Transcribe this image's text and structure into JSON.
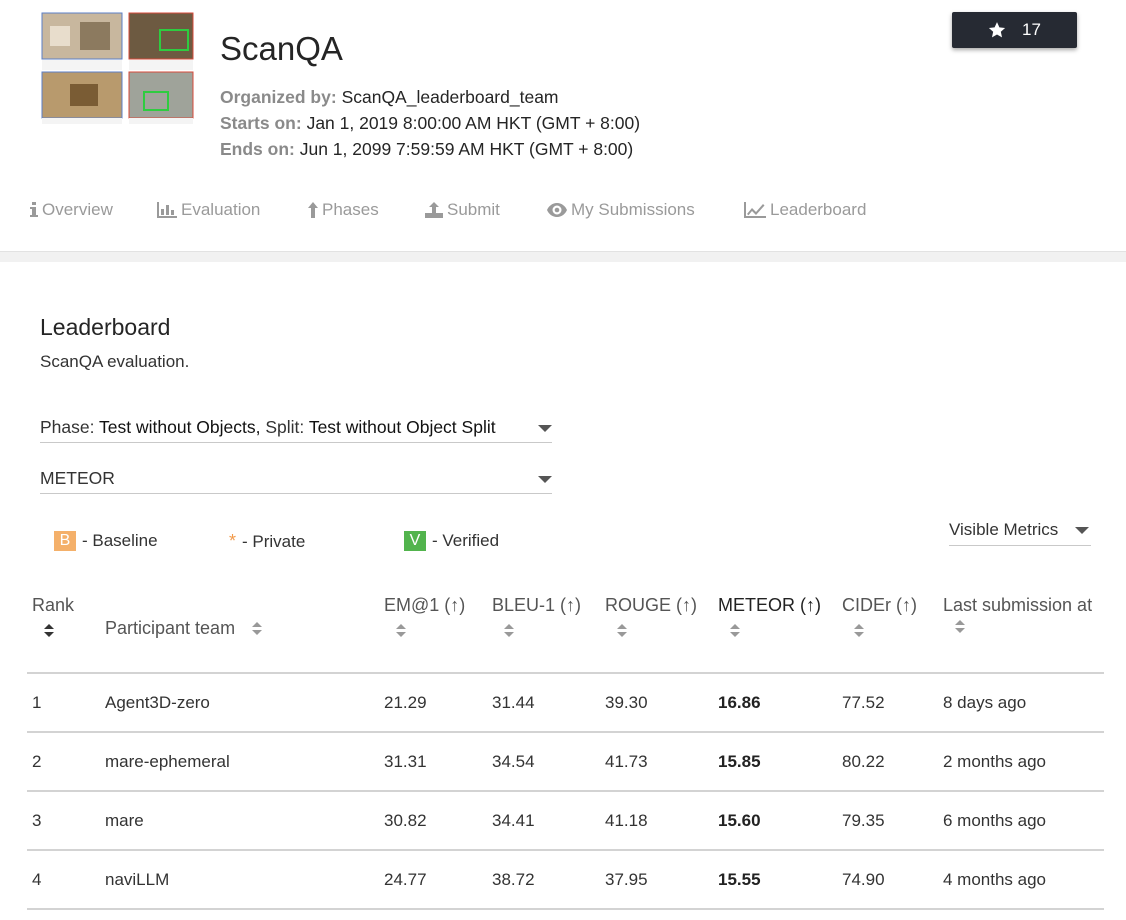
{
  "challenge": {
    "title": "ScanQA",
    "organized_label": "Organized by:",
    "organized_value": "ScanQA_leaderboard_team",
    "starts_label": "Starts on:",
    "starts_value": "Jan 1, 2019 8:00:00 AM HKT (GMT + 8:00)",
    "ends_label": "Ends on:",
    "ends_value": "Jun 1, 2099 7:59:59 AM HKT (GMT + 8:00)",
    "star_count": "17",
    "star_icon": "star-icon"
  },
  "tabs": [
    {
      "label": "Overview",
      "icon": "info-icon"
    },
    {
      "label": "Evaluation",
      "icon": "bar-chart-icon"
    },
    {
      "label": "Phases",
      "icon": "arrow-up-icon"
    },
    {
      "label": "Submit",
      "icon": "upload-icon"
    },
    {
      "label": "My Submissions",
      "icon": "eye-icon"
    },
    {
      "label": "Leaderboard",
      "icon": "line-chart-icon"
    }
  ],
  "leaderboard": {
    "title": "Leaderboard",
    "description": "ScanQA evaluation.",
    "phase_label": "Phase:",
    "phase_value": "Test without Objects,",
    "split_label": "Split:",
    "split_value": "Test without Object Split",
    "metric_select": "METEOR",
    "legend": {
      "baseline_badge": "B",
      "baseline_text": "- Baseline",
      "private_mark": "*",
      "private_text": "- Private",
      "verified_badge": "V",
      "verified_text": "- Verified"
    },
    "visible_metrics": "Visible Metrics",
    "colors": {
      "baseline": "#f4b06a",
      "verified": "#52b44d",
      "private": "#f29a4a",
      "star_button": "#262a33"
    },
    "columns": [
      "Rank",
      "Participant team",
      "EM@1 (↑)",
      "BLEU-1 (↑)",
      "ROUGE (↑)",
      "METEOR (↑)",
      "CIDEr (↑)",
      "Last submission at"
    ],
    "rows": [
      [
        "1",
        "Agent3D-zero",
        "21.29",
        "31.44",
        "39.30",
        "16.86",
        "77.52",
        "8 days ago"
      ],
      [
        "2",
        "mare-ephemeral",
        "31.31",
        "34.54",
        "41.73",
        "15.85",
        "80.22",
        "2 months ago"
      ],
      [
        "3",
        "mare",
        "30.82",
        "34.41",
        "41.18",
        "15.60",
        "79.35",
        "6 months ago"
      ],
      [
        "4",
        "naviLLM",
        "24.77",
        "38.72",
        "37.95",
        "15.55",
        "74.90",
        "4 months ago"
      ]
    ]
  }
}
